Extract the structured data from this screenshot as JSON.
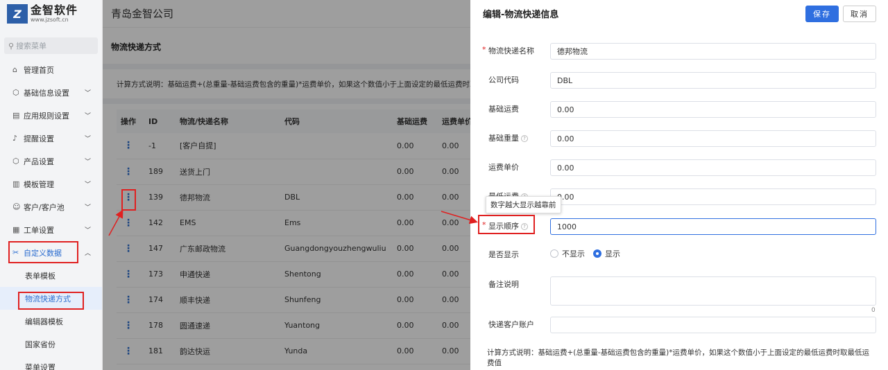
{
  "logo": {
    "mark": "Z",
    "name": "金智软件",
    "url": "www.jzsoft.cn"
  },
  "company": "青岛金智公司",
  "search": {
    "placeholder": "搜索菜单"
  },
  "sidebar": {
    "items": [
      {
        "icon": "home-icon",
        "glyph": "⌂",
        "label": "管理首页",
        "chevron": false
      },
      {
        "icon": "cube-icon",
        "glyph": "⬡",
        "label": "基础信息设置",
        "chevron": true
      },
      {
        "icon": "file-icon",
        "glyph": "▤",
        "label": "应用规则设置",
        "chevron": true
      },
      {
        "icon": "bell-icon",
        "glyph": "♪",
        "label": "提醒设置",
        "chevron": true
      },
      {
        "icon": "product-icon",
        "glyph": "⬡",
        "label": "产品设置",
        "chevron": true
      },
      {
        "icon": "template-icon",
        "glyph": "▥",
        "label": "模板管理",
        "chevron": true
      },
      {
        "icon": "user-icon",
        "glyph": "☺",
        "label": "客户/客户池",
        "chevron": true
      },
      {
        "icon": "ticket-icon",
        "glyph": "▦",
        "label": "工单设置",
        "chevron": true
      },
      {
        "icon": "custom-data-icon",
        "glyph": "✂",
        "label": "自定义数据",
        "chevron": true,
        "expanded": true
      }
    ],
    "sub_items": [
      "表单模板",
      "物流快递方式",
      "编辑器模板",
      "国家省份",
      "菜单设置"
    ],
    "active_sub": "物流快递方式"
  },
  "page": {
    "title": "物流快递方式",
    "calc_note": "计算方式说明：基础运费+(总重量-基础运费包含的重量)*运费单价，如果这个数值小于上面设定的最低运费时取最低运费值"
  },
  "table": {
    "columns": [
      "操作",
      "ID",
      "物流/快递名称",
      "代码",
      "基础运费",
      "运费单价"
    ],
    "rows": [
      {
        "id": "-1",
        "name": "[客户自提]",
        "code": "",
        "base": "0.00",
        "unit": "0.00"
      },
      {
        "id": "189",
        "name": "送货上门",
        "code": "",
        "base": "0.00",
        "unit": "0.00"
      },
      {
        "id": "139",
        "name": "德邦物流",
        "code": "DBL",
        "base": "0.00",
        "unit": "0.00"
      },
      {
        "id": "142",
        "name": "EMS",
        "code": "Ems",
        "base": "0.00",
        "unit": "0.00"
      },
      {
        "id": "147",
        "name": "广东邮政物流",
        "code": "Guangdongyouzhengwuliu",
        "base": "0.00",
        "unit": "0.00"
      },
      {
        "id": "173",
        "name": "申通快递",
        "code": "Shentong",
        "base": "0.00",
        "unit": "0.00"
      },
      {
        "id": "174",
        "name": "顺丰快递",
        "code": "Shunfeng",
        "base": "0.00",
        "unit": "0.00"
      },
      {
        "id": "178",
        "name": "圆通速递",
        "code": "Yuantong",
        "base": "0.00",
        "unit": "0.00"
      },
      {
        "id": "181",
        "name": "韵达快运",
        "code": "Yunda",
        "base": "0.00",
        "unit": "0.00"
      }
    ],
    "action_glyph": "⋮"
  },
  "drawer": {
    "title": "编辑-物流快递信息",
    "save_label": "保存",
    "cancel_label": "取消",
    "fields": {
      "name": {
        "label": "物流快递名称",
        "value": "德邦物流",
        "required": true
      },
      "code": {
        "label": "公司代码",
        "value": "DBL"
      },
      "base_fee": {
        "label": "基础运费",
        "value": "0.00"
      },
      "base_weight": {
        "label": "基础重量",
        "value": "0.00",
        "help": true
      },
      "unit_price": {
        "label": "运费单价",
        "value": "0.00"
      },
      "min_fee": {
        "label": "最低运费",
        "value": "0.00",
        "help": true
      },
      "order": {
        "label": "显示顺序",
        "value": "1000",
        "required": true,
        "help": true
      },
      "visible": {
        "label": "是否显示",
        "options": [
          "不显示",
          "显示"
        ],
        "selected": "显示"
      },
      "remark": {
        "label": "备注说明",
        "value": "",
        "count": "0"
      },
      "account": {
        "label": "快递客户账户",
        "value": ""
      }
    },
    "tooltip": "数字越大显示越靠前",
    "bottom_note": "计算方式说明：基础运费+(总重量-基础运费包含的重量)*运费单价，如果这个数值小于上面设定的最低运费时取最低运费值"
  },
  "colors": {
    "accent": "#2f6fe0",
    "annotation_red": "#e02020"
  }
}
